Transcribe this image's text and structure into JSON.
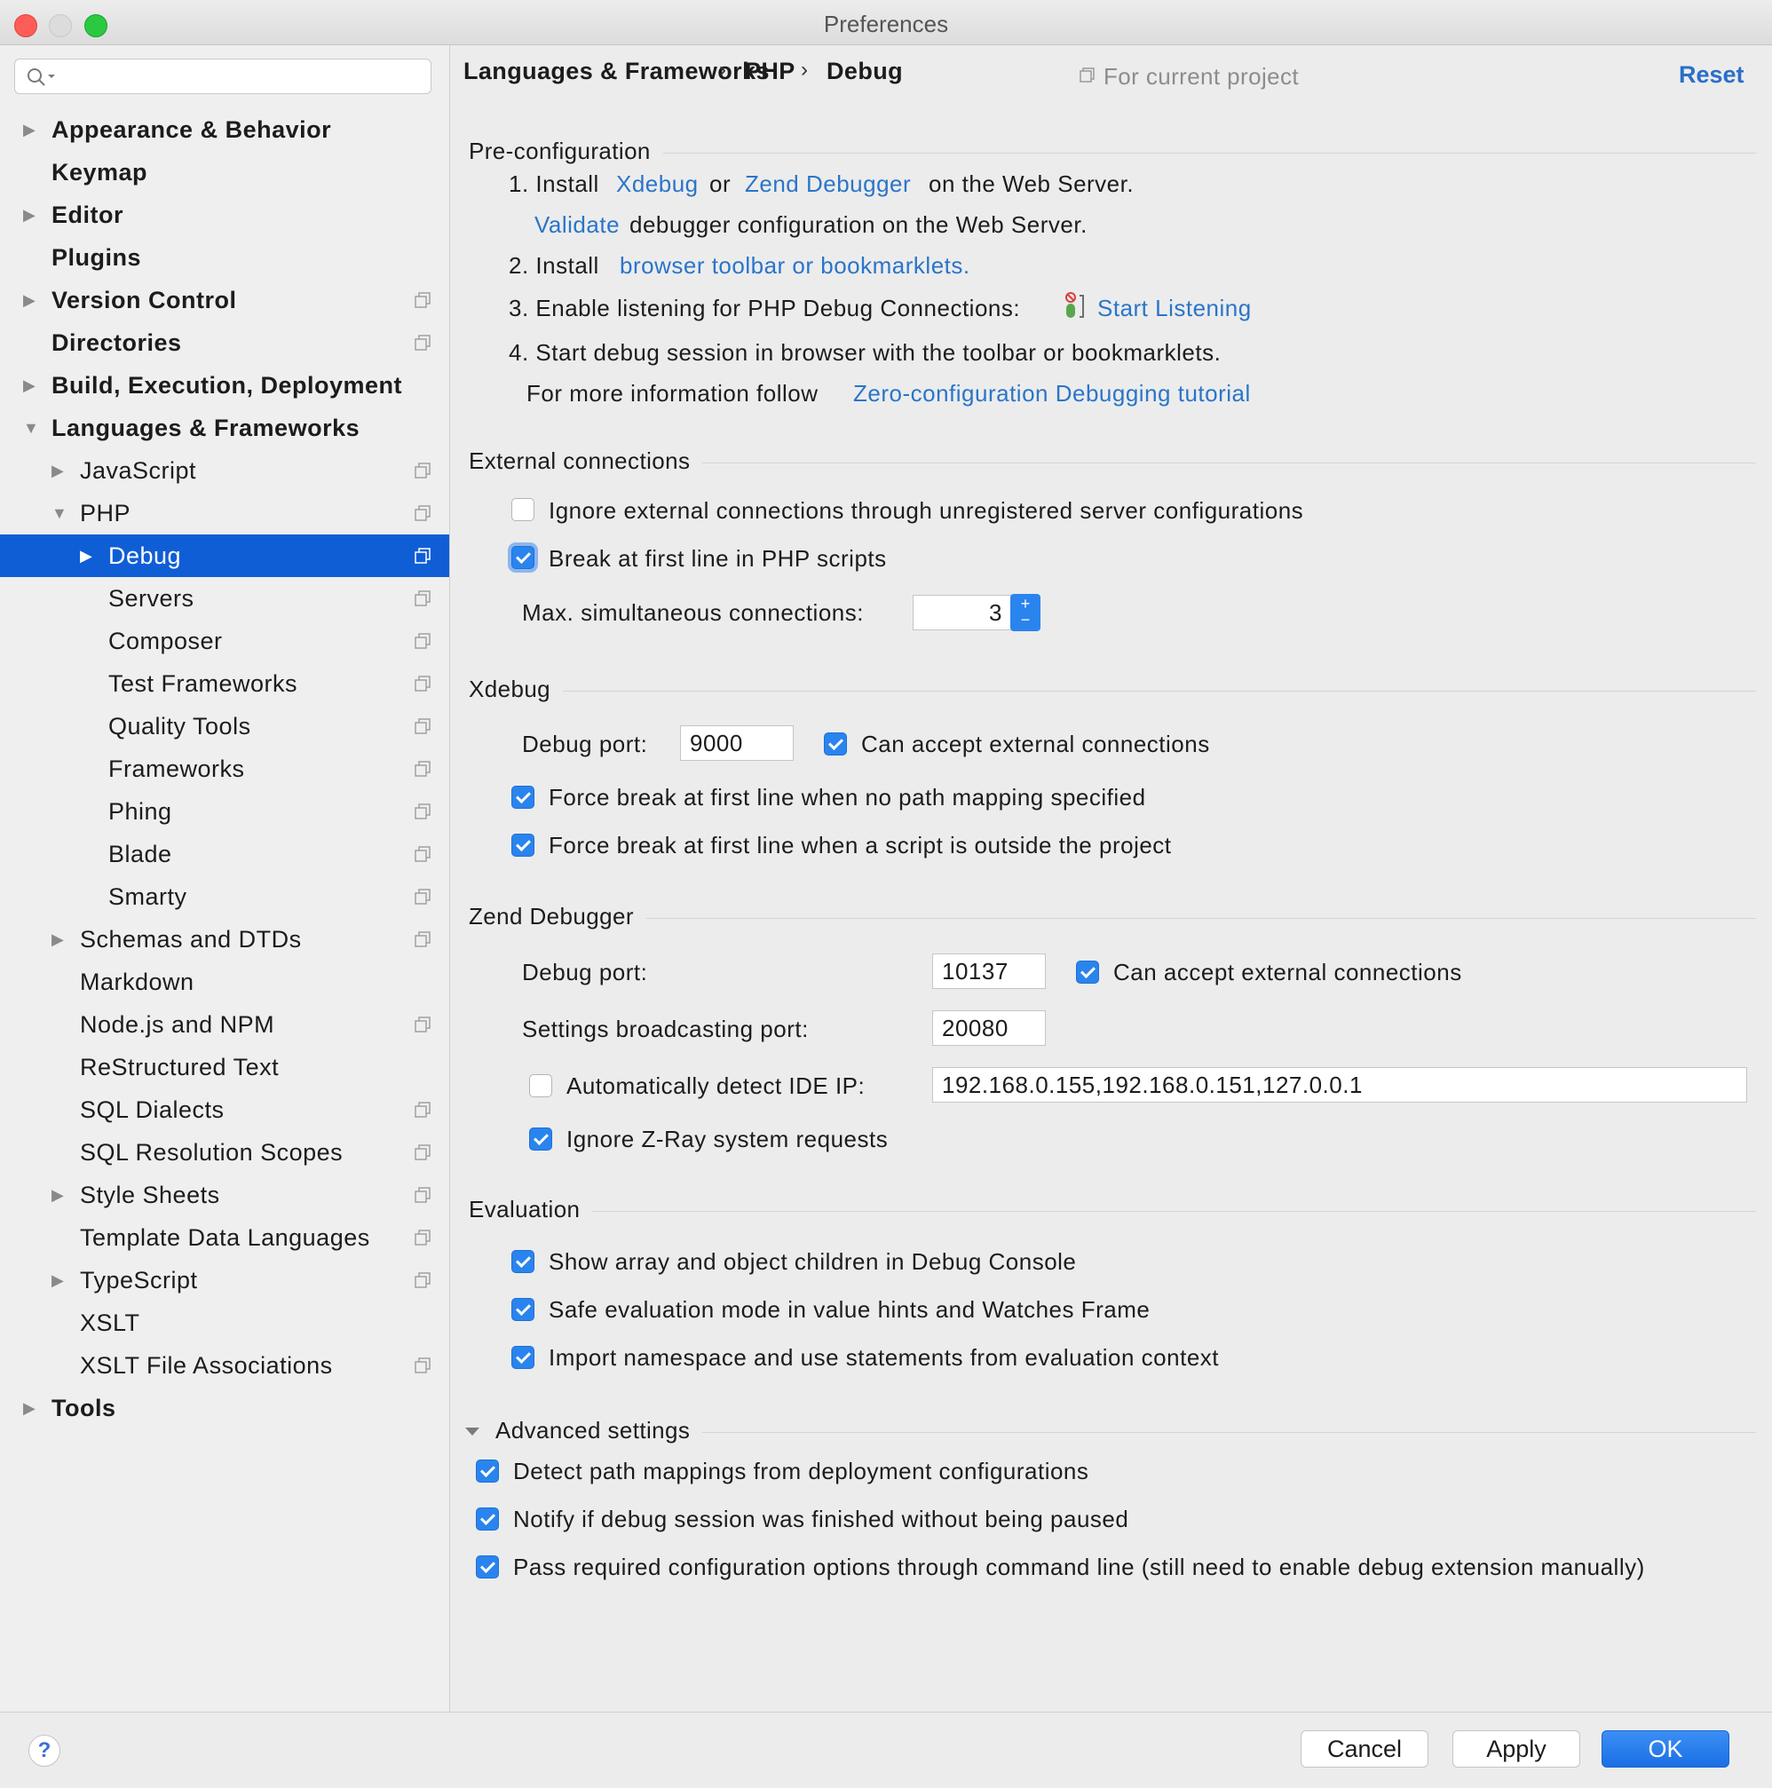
{
  "window": {
    "title": "Preferences"
  },
  "search": {
    "placeholder": "",
    "value": ""
  },
  "sidebar": {
    "items": [
      {
        "label": "Appearance & Behavior",
        "level": 0,
        "bold": true,
        "arrow": "right",
        "project_icon": false
      },
      {
        "label": "Keymap",
        "level": 0,
        "bold": true,
        "arrow": "none",
        "project_icon": false
      },
      {
        "label": "Editor",
        "level": 0,
        "bold": true,
        "arrow": "right",
        "project_icon": false
      },
      {
        "label": "Plugins",
        "level": 0,
        "bold": true,
        "arrow": "none",
        "project_icon": false
      },
      {
        "label": "Version Control",
        "level": 0,
        "bold": true,
        "arrow": "right",
        "project_icon": true
      },
      {
        "label": "Directories",
        "level": 0,
        "bold": true,
        "arrow": "none",
        "project_icon": true
      },
      {
        "label": "Build, Execution, Deployment",
        "level": 0,
        "bold": true,
        "arrow": "right",
        "project_icon": false
      },
      {
        "label": "Languages & Frameworks",
        "level": 0,
        "bold": true,
        "arrow": "down",
        "project_icon": false
      },
      {
        "label": "JavaScript",
        "level": 1,
        "bold": false,
        "arrow": "right",
        "project_icon": true
      },
      {
        "label": "PHP",
        "level": 1,
        "bold": false,
        "arrow": "down",
        "project_icon": true
      },
      {
        "label": "Debug",
        "level": 2,
        "bold": false,
        "arrow": "right",
        "project_icon": true,
        "selected": true
      },
      {
        "label": "Servers",
        "level": 2,
        "bold": false,
        "arrow": "none",
        "project_icon": true
      },
      {
        "label": "Composer",
        "level": 2,
        "bold": false,
        "arrow": "none",
        "project_icon": true
      },
      {
        "label": "Test Frameworks",
        "level": 2,
        "bold": false,
        "arrow": "none",
        "project_icon": true
      },
      {
        "label": "Quality Tools",
        "level": 2,
        "bold": false,
        "arrow": "none",
        "project_icon": true
      },
      {
        "label": "Frameworks",
        "level": 2,
        "bold": false,
        "arrow": "none",
        "project_icon": true
      },
      {
        "label": "Phing",
        "level": 2,
        "bold": false,
        "arrow": "none",
        "project_icon": true
      },
      {
        "label": "Blade",
        "level": 2,
        "bold": false,
        "arrow": "none",
        "project_icon": true
      },
      {
        "label": "Smarty",
        "level": 2,
        "bold": false,
        "arrow": "none",
        "project_icon": true
      },
      {
        "label": "Schemas and DTDs",
        "level": 1,
        "bold": false,
        "arrow": "right",
        "project_icon": true
      },
      {
        "label": "Markdown",
        "level": 1,
        "bold": false,
        "arrow": "none",
        "project_icon": false
      },
      {
        "label": "Node.js and NPM",
        "level": 1,
        "bold": false,
        "arrow": "none",
        "project_icon": true
      },
      {
        "label": "ReStructured Text",
        "level": 1,
        "bold": false,
        "arrow": "none",
        "project_icon": false
      },
      {
        "label": "SQL Dialects",
        "level": 1,
        "bold": false,
        "arrow": "none",
        "project_icon": true
      },
      {
        "label": "SQL Resolution Scopes",
        "level": 1,
        "bold": false,
        "arrow": "none",
        "project_icon": true
      },
      {
        "label": "Style Sheets",
        "level": 1,
        "bold": false,
        "arrow": "right",
        "project_icon": true
      },
      {
        "label": "Template Data Languages",
        "level": 1,
        "bold": false,
        "arrow": "none",
        "project_icon": true
      },
      {
        "label": "TypeScript",
        "level": 1,
        "bold": false,
        "arrow": "right",
        "project_icon": true
      },
      {
        "label": "XSLT",
        "level": 1,
        "bold": false,
        "arrow": "none",
        "project_icon": false
      },
      {
        "label": "XSLT File Associations",
        "level": 1,
        "bold": false,
        "arrow": "none",
        "project_icon": true
      },
      {
        "label": "Tools",
        "level": 0,
        "bold": true,
        "arrow": "right",
        "project_icon": false
      }
    ]
  },
  "header": {
    "breadcrumb": [
      "Languages & Frameworks",
      "PHP",
      "Debug"
    ],
    "separator": "›",
    "for_project": "For current project",
    "reset": "Reset"
  },
  "preconfig": {
    "title": "Pre-configuration",
    "step1_prefix": "1. Install",
    "step1_link1": "Xdebug",
    "step1_or": "or",
    "step1_link2": "Zend Debugger",
    "step1_suffix": "on the Web Server.",
    "validate_link": "Validate",
    "validate_suffix": "debugger configuration on the Web Server.",
    "step2_prefix": "2. Install",
    "step2_link": "browser toolbar or bookmarklets.",
    "step3_prefix": "3. Enable listening for PHP Debug Connections:",
    "step3_link": "Start Listening",
    "step4": "4. Start debug session in browser with the toolbar or bookmarklets.",
    "more_prefix": "For more information follow",
    "more_link": "Zero-configuration Debugging tutorial"
  },
  "external": {
    "title": "External connections",
    "ignore_label": "Ignore external connections through unregistered server configurations",
    "ignore_checked": false,
    "break_label": "Break at first line in PHP scripts",
    "break_checked": true,
    "max_label": "Max. simultaneous connections:",
    "max_value": "3",
    "plus": "+",
    "minus": "−"
  },
  "xdebug": {
    "title": "Xdebug",
    "port_label": "Debug port:",
    "port_value": "9000",
    "accept_label": "Can accept external connections",
    "accept_checked": true,
    "force_nopath_label": "Force break at first line when no path mapping specified",
    "force_nopath_checked": true,
    "force_outside_label": "Force break at first line when a script is outside the project",
    "force_outside_checked": true
  },
  "zend": {
    "title": "Zend Debugger",
    "port_label": "Debug port:",
    "port_value": "10137",
    "accept_label": "Can accept external connections",
    "accept_checked": true,
    "broadcast_label": "Settings broadcasting port:",
    "broadcast_value": "20080",
    "detect_label": "Automatically detect IDE IP:",
    "detect_checked": false,
    "ip_value": "192.168.0.155,192.168.0.151,127.0.0.1",
    "zray_label": "Ignore Z-Ray system requests",
    "zray_checked": true
  },
  "evaluation": {
    "title": "Evaluation",
    "show_children_label": "Show array and object children in Debug Console",
    "safe_mode_label": "Safe evaluation mode in value hints and Watches Frame",
    "import_ns_label": "Import namespace and use statements from evaluation context"
  },
  "advanced": {
    "title": "Advanced settings",
    "detect_mappings_label": "Detect path mappings from deployment configurations",
    "notify_label": "Notify if debug session was finished without being paused",
    "pass_options_label": "Pass required configuration options through command line (still need to enable debug extension manually)"
  },
  "footer": {
    "help": "?",
    "cancel": "Cancel",
    "apply": "Apply",
    "ok": "OK"
  },
  "colors": {
    "accent": "#2a84ee",
    "selection": "#0f5ed6",
    "link": "#2a75c9"
  }
}
